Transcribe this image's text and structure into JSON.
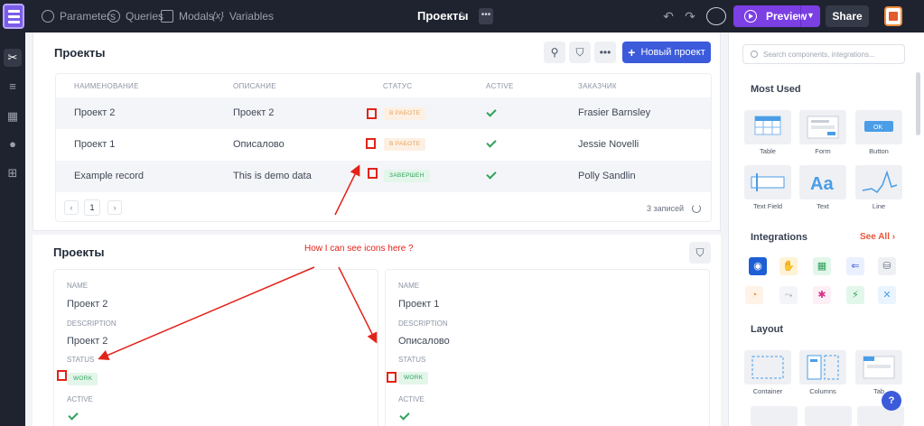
{
  "topbar": {
    "links": [
      "Parameters",
      "Queries",
      "Modals",
      "Variables"
    ],
    "page_name": "Проекты",
    "more": "•••",
    "preview_label": "Preview",
    "share_label": "Share"
  },
  "table_section": {
    "title": "Проекты",
    "new_button_label": "Новый проект",
    "columns": [
      "НАИМЕНОВАНИЕ",
      "ОПИСАНИЕ",
      "СТАТУС",
      "ACTIVE",
      "ЗАКАЗЧИК"
    ],
    "rows": [
      {
        "name": "Проект 2",
        "description": "Проект 2",
        "status": "В РАБОТЕ",
        "status_color": "orange",
        "customer": "Frasier Barnsley"
      },
      {
        "name": "Проект 1",
        "description": "Описалово",
        "status": "В РАБОТЕ",
        "status_color": "orange",
        "customer": "Jessie Novelli"
      },
      {
        "name": "Example record",
        "description": "This is demo data",
        "status": "ЗАВЕРШЕН",
        "status_color": "green",
        "customer": "Polly Sandlin"
      }
    ],
    "page": "1",
    "records_label": "3 записей"
  },
  "list_section": {
    "title": "Проекты",
    "items": [
      {
        "name_label": "NAME",
        "name": "Проект 2",
        "desc_label": "DESCRIPTION",
        "desc": "Проект 2",
        "status_label": "STATUS",
        "status": "WORK",
        "active_label": "ACTIVE"
      },
      {
        "name_label": "NAME",
        "name": "Проект 1",
        "desc_label": "DESCRIPTION",
        "desc": "Описалово",
        "status_label": "STATUS",
        "status": "WORK",
        "active_label": "ACTIVE"
      }
    ]
  },
  "annotation": {
    "text": "How I can see icons here ?",
    "color": "#e2231a"
  },
  "right_panel": {
    "search_placeholder": "Search components, integrations...",
    "most_used_title": "Most Used",
    "most_used": [
      "Table",
      "Form",
      "Button",
      "Text Field",
      "Text",
      "Line"
    ],
    "integrations_title": "Integrations",
    "see_all": "See All",
    "layout_title": "Layout",
    "layout": [
      "Container",
      "Columns",
      "Tab"
    ],
    "help": "?"
  },
  "colors": {
    "accent": "#7b3fe4",
    "primary": "#3b5bdb",
    "success": "#2fa15b",
    "warning": "#e6a15c"
  }
}
